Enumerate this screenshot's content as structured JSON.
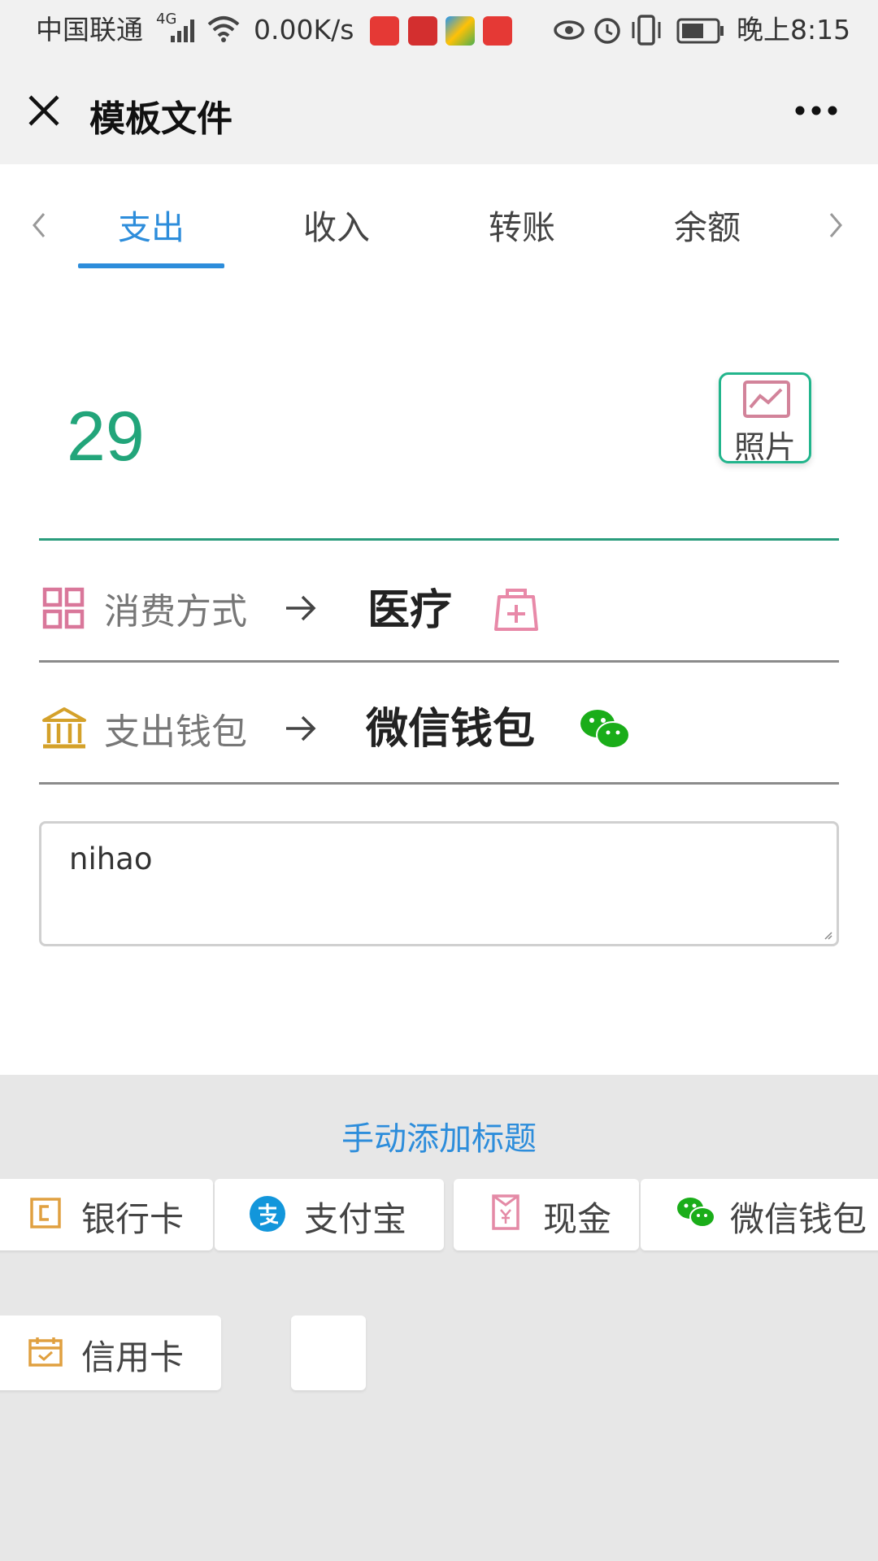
{
  "status_bar": {
    "carrier": "中国联通",
    "network": "4G",
    "speed": "0.00K/s",
    "time": "晚上8:15"
  },
  "nav": {
    "title": "模板文件"
  },
  "tabs": [
    {
      "label": "支出",
      "active": true
    },
    {
      "label": "收入",
      "active": false
    },
    {
      "label": "转账",
      "active": false
    },
    {
      "label": "余额",
      "active": false
    }
  ],
  "entry": {
    "amount": "29",
    "photo_label": "照片",
    "category_label": "消费方式",
    "category_value": "医疗",
    "wallet_label": "支出钱包",
    "wallet_value": "微信钱包",
    "note": "nihao"
  },
  "wallet_picker": {
    "title": "手动添加标题",
    "options": [
      {
        "label": "银行卡",
        "icon": "wallet-card-icon"
      },
      {
        "label": "支付宝",
        "icon": "alipay-icon"
      },
      {
        "label": "现金",
        "icon": "cash-icon"
      },
      {
        "label": "微信钱包",
        "icon": "wechat-icon"
      },
      {
        "label": "信用卡",
        "icon": "credit-card-icon"
      }
    ]
  },
  "colors": {
    "accent_blue": "#2d8ddb",
    "amount_green": "#22a57a",
    "wechat_green": "#1aad19"
  }
}
